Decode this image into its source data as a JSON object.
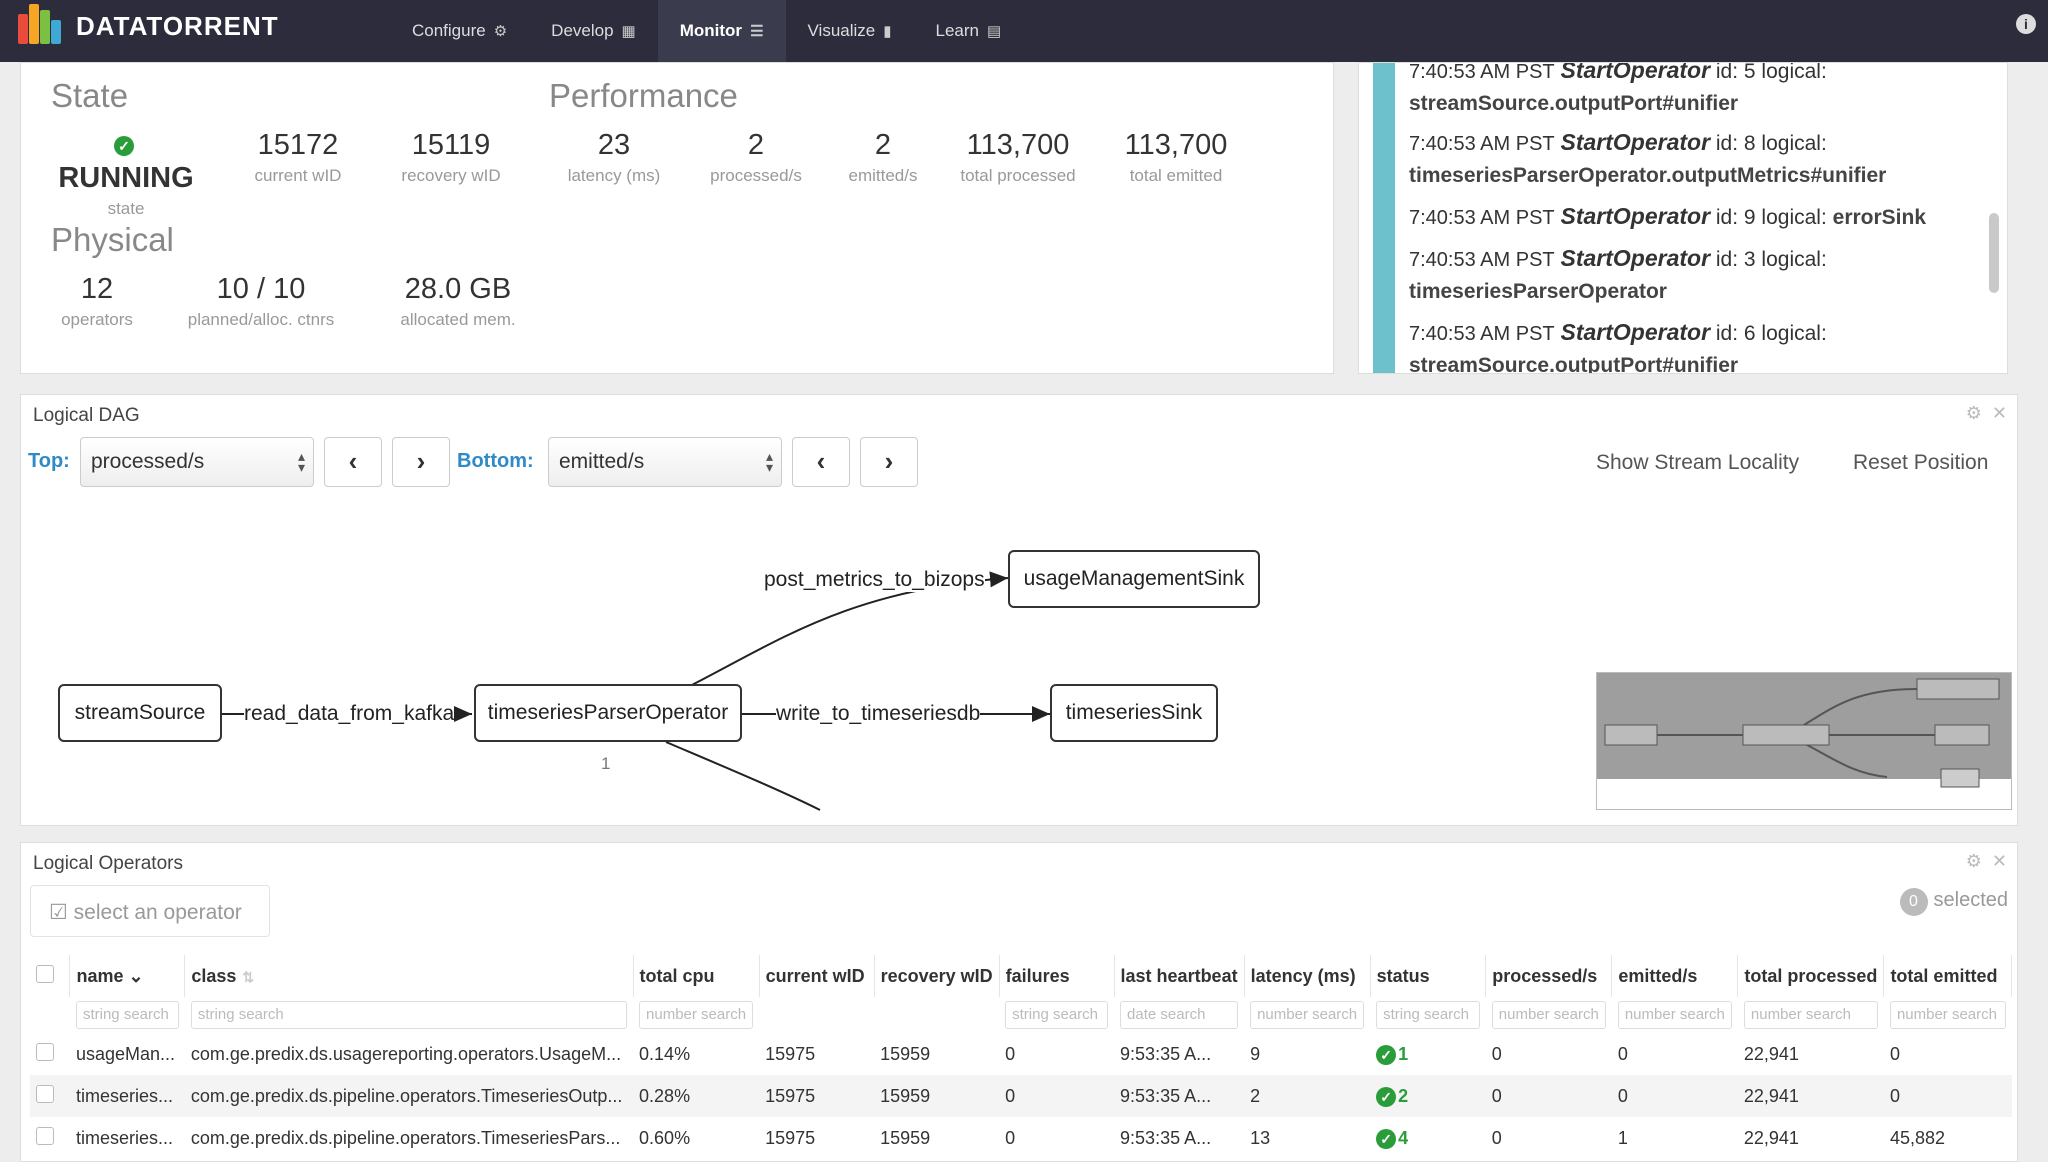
{
  "app": {
    "name": "DATATORRENT",
    "colors": {
      "topbar": "#2c2c3c",
      "accent": "#2f8ac8",
      "running": "#2a9d3a",
      "log_bar": "#6cc1cc"
    }
  },
  "nav": [
    {
      "label": "Configure",
      "icon": "gear-icon"
    },
    {
      "label": "Develop",
      "icon": "grid-icon"
    },
    {
      "label": "Monitor",
      "icon": "list-icon",
      "active": true
    },
    {
      "label": "Visualize",
      "icon": "bar-chart-icon"
    },
    {
      "label": "Learn",
      "icon": "book-icon"
    }
  ],
  "overview": {
    "state_title": "State",
    "state": {
      "value": "RUNNING",
      "label": "state"
    },
    "current_wid": {
      "value": "15172",
      "label": "current wID"
    },
    "recovery_wid": {
      "value": "15119",
      "label": "recovery wID"
    },
    "performance_title": "Performance",
    "latency": {
      "value": "23",
      "label": "latency (ms)"
    },
    "processed": {
      "value": "2",
      "label": "processed/s"
    },
    "emitted": {
      "value": "2",
      "label": "emitted/s"
    },
    "total_processed": {
      "value": "113,700",
      "label": "total processed"
    },
    "total_emitted": {
      "value": "113,700",
      "label": "total emitted"
    },
    "physical_title": "Physical",
    "operators": {
      "value": "12",
      "label": "operators"
    },
    "containers": {
      "value": "10 / 10",
      "label": "planned/alloc. ctnrs"
    },
    "memory": {
      "value": "28.0 GB",
      "label": "allocated mem."
    }
  },
  "log": [
    {
      "time": "7:40:53 AM PST",
      "op": "StartOperator",
      "id": "id: 5",
      "logical": "logical:",
      "target": "streamSource.outputPort#unifier"
    },
    {
      "time": "7:40:53 AM PST",
      "op": "StartOperator",
      "id": "id: 8",
      "logical": "logical:",
      "target": "timeseriesParserOperator.outputMetrics#unifier"
    },
    {
      "time": "7:40:53 AM PST",
      "op": "StartOperator",
      "id": "id: 9",
      "logical": "logical:",
      "target": "errorSink"
    },
    {
      "time": "7:40:53 AM PST",
      "op": "StartOperator",
      "id": "id: 3",
      "logical": "logical:",
      "target": "timeseriesParserOperator"
    },
    {
      "time": "7:40:53 AM PST",
      "op": "StartOperator",
      "id": "id: 6",
      "logical": "logical:",
      "target": "streamSource.outputPort#unifier"
    }
  ],
  "dag": {
    "title": "Logical DAG",
    "top_label": "Top:",
    "top_value": "processed/s",
    "bottom_label": "Bottom:",
    "bottom_value": "emitted/s",
    "show_locality": "Show Stream Locality",
    "reset_position": "Reset Position",
    "nodes": {
      "streamSource": "streamSource",
      "parser": "timeseriesParserOperator",
      "usageSink": "usageManagementSink",
      "tsSink": "timeseriesSink"
    },
    "edges": {
      "kafka": "read_data_from_kafka",
      "tsdb": "write_to_timeseriesdb",
      "bizops": "post_metrics_to_bizops"
    },
    "parser_metric": "1"
  },
  "operators": {
    "title": "Logical Operators",
    "select_btn": "select an operator",
    "selected_count": "0",
    "selected_label": "selected",
    "columns": [
      "name",
      "class",
      "total cpu",
      "current wID",
      "recovery wID",
      "failures",
      "last heartbeat",
      "latency (ms)",
      "status",
      "processed/s",
      "emitted/s",
      "total processed",
      "total emitted"
    ],
    "filters": [
      "string search",
      "string search",
      "number search",
      "",
      "",
      "string search",
      "date search",
      "number search",
      "string search",
      "number search",
      "number search",
      "number search",
      "number search"
    ],
    "rows": [
      [
        "usageMan...",
        "com.ge.predix.ds.usagereporting.operators.UsageM...",
        "0.14%",
        "15975",
        "15959",
        "0",
        "9:53:35 A...",
        "9",
        "1",
        "0",
        "0",
        "22,941",
        "0"
      ],
      [
        "timeseries...",
        "com.ge.predix.ds.pipeline.operators.TimeseriesOutp...",
        "0.28%",
        "15975",
        "15959",
        "0",
        "9:53:35 A...",
        "2",
        "2",
        "0",
        "0",
        "22,941",
        "0"
      ],
      [
        "timeseries...",
        "com.ge.predix.ds.pipeline.operators.TimeseriesPars...",
        "0.60%",
        "15975",
        "15959",
        "0",
        "9:53:35 A...",
        "13",
        "4",
        "0",
        "1",
        "22,941",
        "45,882"
      ]
    ]
  }
}
